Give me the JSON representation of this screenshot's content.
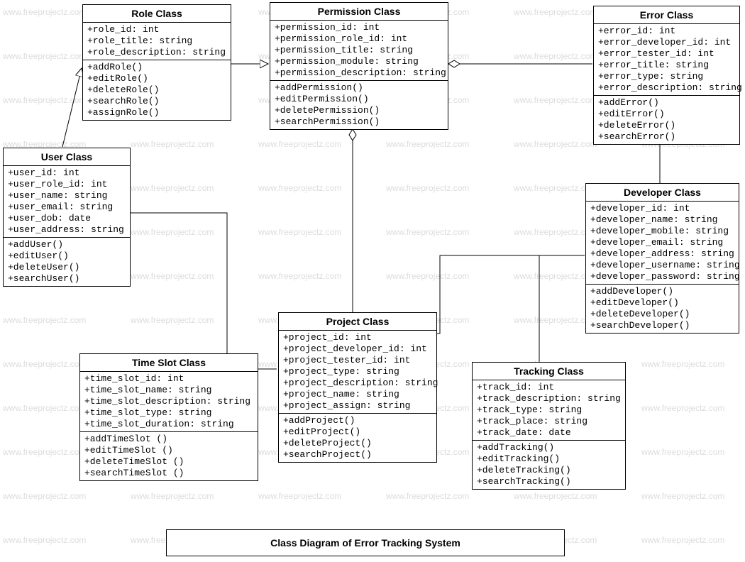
{
  "title": "Class Diagram of Error Tracking System",
  "watermark_text": "www.freeprojectz.com",
  "classes": {
    "role": {
      "name": "Role Class",
      "attrs": [
        "+role_id: int",
        "+role_title: string",
        "+role_description: string"
      ],
      "ops": [
        "+addRole()",
        "+editRole()",
        "+deleteRole()",
        "+searchRole()",
        "+assignRole()"
      ]
    },
    "permission": {
      "name": "Permission Class",
      "attrs": [
        "+permission_id: int",
        "+permission_role_id: int",
        "+permission_title: string",
        "+permission_module: string",
        "+permission_description: string"
      ],
      "ops": [
        "+addPermission()",
        "+editPermission()",
        "+deletePermission()",
        "+searchPermission()"
      ]
    },
    "error": {
      "name": "Error Class",
      "attrs": [
        "+error_id: int",
        "+error_developer_id: int",
        "+error_tester_id: int",
        "+error_title: string",
        "+error_type: string",
        "+error_description: string"
      ],
      "ops": [
        "+addError()",
        "+editError()",
        "+deleteError()",
        "+searchError()"
      ]
    },
    "user": {
      "name": "User Class",
      "attrs": [
        "+user_id: int",
        "+user_role_id: int",
        "+user_name: string",
        "+user_email: string",
        "+user_dob: date",
        "+user_address: string"
      ],
      "ops": [
        "+addUser()",
        "+editUser()",
        "+deleteUser()",
        "+searchUser()"
      ]
    },
    "developer": {
      "name": "Developer Class",
      "attrs": [
        "+developer_id: int",
        "+developer_name: string",
        "+developer_mobile: string",
        "+developer_email: string",
        "+developer_address: string",
        "+developer_username: string",
        "+developer_password: string"
      ],
      "ops": [
        "+addDeveloper()",
        "+editDeveloper()",
        "+deleteDeveloper()",
        "+searchDeveloper()"
      ]
    },
    "timeslot": {
      "name": "Time Slot Class",
      "attrs": [
        "+time_slot_id: int",
        "+time_slot_name: string",
        "+time_slot_description: string",
        "+time_slot_type: string",
        "+time_slot_duration: string"
      ],
      "ops": [
        "+addTimeSlot ()",
        "+editTimeSlot ()",
        "+deleteTimeSlot ()",
        "+searchTimeSlot ()"
      ]
    },
    "project": {
      "name": "Project Class",
      "attrs": [
        "+project_id: int",
        "+project_developer_id: int",
        "+project_tester_id: int",
        "+project_type: string",
        "+project_description: string",
        "+project_name: string",
        "+project_assign: string"
      ],
      "ops": [
        "+addProject()",
        "+editProject()",
        "+deleteProject()",
        "+searchProject()"
      ]
    },
    "tracking": {
      "name": "Tracking Class",
      "attrs": [
        "+track_id: int",
        "+track_description: string",
        "+track_type: string",
        "+track_place: string",
        "+track_date: date"
      ],
      "ops": [
        "+addTracking()",
        "+editTracking()",
        "+deleteTracking()",
        "+searchTracking()"
      ]
    }
  }
}
